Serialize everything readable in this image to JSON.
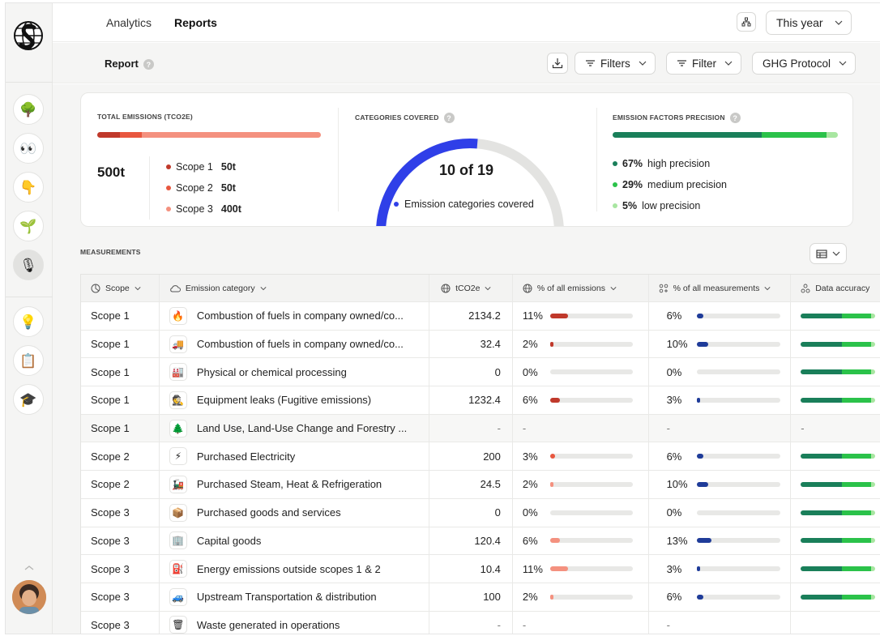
{
  "topbar": {
    "tabs": [
      {
        "label": "Analytics"
      },
      {
        "label": "Reports"
      }
    ],
    "period": "This year"
  },
  "subbar": {
    "title": "Report",
    "filters_label": "Filters",
    "filter_label": "Filter",
    "protocol_label": "GHG Protocol"
  },
  "sidebar": {
    "items": [
      {
        "icon": "tree-icon",
        "glyph": "🌳"
      },
      {
        "icon": "eyes-icon",
        "glyph": "👀"
      },
      {
        "icon": "pointing-hand-icon",
        "glyph": "👇"
      },
      {
        "icon": "seedling-icon",
        "glyph": "🌱"
      },
      {
        "icon": "microphone-icon",
        "glyph": "🎙"
      },
      {
        "icon": "light-bulb-icon",
        "glyph": "💡"
      },
      {
        "icon": "clipboard-icon",
        "glyph": "📋"
      },
      {
        "icon": "graduation-cap-icon",
        "glyph": "🎓"
      }
    ]
  },
  "summary": {
    "total": {
      "label": "TOTAL EMISSIONS (TCO2E)",
      "value": "500t",
      "scopes": [
        {
          "name": "Scope 1",
          "value": "50t",
          "color": "#c0392b",
          "share": 0.1
        },
        {
          "name": "Scope 2",
          "value": "50t",
          "color": "#e8573f",
          "share": 0.1
        },
        {
          "name": "Scope 3",
          "value": "400t",
          "color": "#f4917f",
          "share": 0.8
        }
      ]
    },
    "categories": {
      "label": "CATEGORIES COVERED",
      "value": "10 of 19",
      "legend": "Emission categories covered",
      "covered": 10,
      "total": 19,
      "color": "#2f3fe8"
    },
    "precision": {
      "label": "EMISSION FACTORS PRECISION",
      "items": [
        {
          "pct": "67%",
          "text": "high precision",
          "color": "#1a7f5a",
          "share": 0.67
        },
        {
          "pct": "29%",
          "text": "medium precision",
          "color": "#2bc24a",
          "share": 0.29
        },
        {
          "pct": "5%",
          "text": "low precision",
          "color": "#a8e6a1",
          "share": 0.05
        }
      ]
    }
  },
  "measurements": {
    "label": "MEASUREMENTS",
    "columns": {
      "scope": "Scope",
      "category": "Emission category",
      "tco2e": "tCO2e",
      "pct_emissions": "% of all emissions",
      "pct_measurements": "% of all measurements",
      "accuracy": "Data accuracy"
    },
    "rows": [
      {
        "scope": "Scope 1",
        "icon": "fire-icon",
        "glyph": "🔥",
        "category": "Combustion of fuels in company owned/co...",
        "tco2e": "2134.2",
        "pe": "11%",
        "pe_v": 0.11,
        "pe_c": "#c0392b",
        "pm": "6%",
        "pm_v": 0.06,
        "acc": true
      },
      {
        "scope": "Scope 1",
        "icon": "truck-icon",
        "glyph": "🚚",
        "category": "Combustion of fuels in company owned/co...",
        "tco2e": "32.4",
        "pe": "2%",
        "pe_v": 0.02,
        "pe_c": "#c0392b",
        "pm": "10%",
        "pm_v": 0.1,
        "acc": true
      },
      {
        "scope": "Scope 1",
        "icon": "factory-icon",
        "glyph": "🏭",
        "category": "Physical or chemical processing",
        "tco2e": "0",
        "pe": "0%",
        "pe_v": 0,
        "pe_c": "#c0392b",
        "pm": "0%",
        "pm_v": 0,
        "acc": true
      },
      {
        "scope": "Scope 1",
        "icon": "detective-icon",
        "glyph": "🕵",
        "category": "Equipment leaks (Fugitive emissions)",
        "tco2e": "1232.4",
        "pe": "6%",
        "pe_v": 0.06,
        "pe_c": "#c0392b",
        "pm": "3%",
        "pm_v": 0.03,
        "acc": true
      },
      {
        "scope": "Scope 1",
        "icon": "evergreen-tree-icon",
        "glyph": "🌲",
        "category": "Land Use, Land-Use Change and Forestry ...",
        "tco2e": "-",
        "pe": "-",
        "pe_v": null,
        "pe_c": "",
        "pm": "-",
        "pm_v": null,
        "acc": false,
        "muted": true
      },
      {
        "scope": "Scope 2",
        "icon": "lightning-icon",
        "glyph": "⚡",
        "category": "Purchased Electricity",
        "tco2e": "200",
        "pe": "3%",
        "pe_v": 0.03,
        "pe_c": "#e8573f",
        "pm": "6%",
        "pm_v": 0.06,
        "acc": true
      },
      {
        "scope": "Scope 2",
        "icon": "locomotive-icon",
        "glyph": "🚂",
        "category": "Purchased Steam, Heat & Refrigeration",
        "tco2e": "24.5",
        "pe": "2%",
        "pe_v": 0.02,
        "pe_c": "#f4917f",
        "pm": "10%",
        "pm_v": 0.1,
        "acc": true
      },
      {
        "scope": "Scope 3",
        "icon": "package-icon",
        "glyph": "📦",
        "category": "Purchased goods and services",
        "tco2e": "0",
        "pe": "0%",
        "pe_v": 0,
        "pe_c": "#f4917f",
        "pm": "0%",
        "pm_v": 0,
        "acc": true
      },
      {
        "scope": "Scope 3",
        "icon": "building-icon",
        "glyph": "🏢",
        "category": "Capital goods",
        "tco2e": "120.4",
        "pe": "6%",
        "pe_v": 0.06,
        "pe_c": "#f4917f",
        "pm": "13%",
        "pm_v": 0.13,
        "acc": true
      },
      {
        "scope": "Scope 3",
        "icon": "fuel-pump-icon",
        "glyph": "⛽",
        "category": "Energy emissions outside scopes 1 & 2",
        "tco2e": "10.4",
        "pe": "11%",
        "pe_v": 0.11,
        "pe_c": "#f4917f",
        "pm": "3%",
        "pm_v": 0.03,
        "acc": true
      },
      {
        "scope": "Scope 3",
        "icon": "car-icon",
        "glyph": "🚙",
        "category": "Upstream Transportation & distribution",
        "tco2e": "100",
        "pe": "2%",
        "pe_v": 0.02,
        "pe_c": "#f4917f",
        "pm": "6%",
        "pm_v": 0.06,
        "acc": true
      },
      {
        "scope": "Scope 3",
        "icon": "trash-icon",
        "glyph": "🗑",
        "category": "Waste generated in operations",
        "tco2e": "-",
        "pe": "-",
        "pe_v": null,
        "pe_c": "",
        "pm": "-",
        "pm_v": null,
        "acc": false
      }
    ],
    "accuracy_colors": [
      "#1a7f5a",
      "#2bc24a",
      "#a8e6a1"
    ],
    "pm_color": "#1f3c99"
  }
}
